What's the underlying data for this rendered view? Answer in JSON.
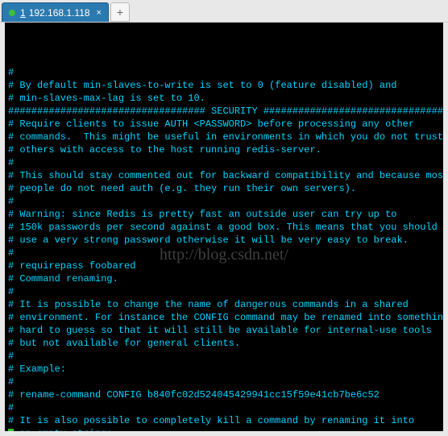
{
  "tab": {
    "number": "1",
    "title": "192.168.1.118",
    "close_glyph": "×",
    "add_glyph": "+"
  },
  "watermark": "http://blog.csdn.net/",
  "terminal": {
    "lines": [
      "#",
      "# By default min-slaves-to-write is set to 0 (feature disabled) and",
      "# min-slaves-max-lag is set to 10.",
      "",
      "################################## SECURITY ###################################",
      "",
      "# Require clients to issue AUTH <PASSWORD> before processing any other",
      "# commands.  This might be useful in environments in which you do not trust",
      "# others with access to the host running redis-server.",
      "#",
      "# This should stay commented out for backward compatibility and because most",
      "# people do not need auth (e.g. they run their own servers).",
      "#",
      "# Warning: since Redis is pretty fast an outside user can try up to",
      "# 150k passwords per second against a good box. This means that you should",
      "# use a very strong password otherwise it will be very easy to break.",
      "#",
      "# requirepass foobared",
      "",
      "# Command renaming.",
      "#",
      "# It is possible to change the name of dangerous commands in a shared",
      "# environment. For instance the CONFIG command may be renamed into something",
      "# hard to guess so that it will still be available for internal-use tools",
      "# but not available for general clients.",
      "#",
      "# Example:",
      "#",
      "# rename-command CONFIG b840fc02d524045429941cc15f59e41cb7be6c52",
      "#",
      "# It is also possible to completely kill a command by renaming it into",
      "# an empty string:"
    ]
  }
}
